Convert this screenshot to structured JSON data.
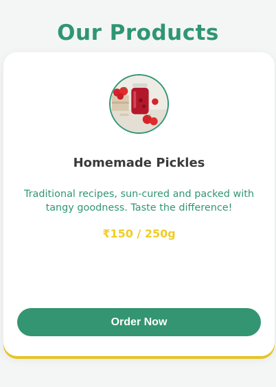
{
  "section": {
    "title": "Our Products"
  },
  "product": {
    "image_icon": "strawberry-jam-jar-image",
    "name": "Homemade Pickles",
    "description": "Traditional recipes, sun-cured and packed with tangy goodness. Taste the difference!",
    "price": "₹150 / 250g",
    "cta_label": "Order Now"
  },
  "colors": {
    "accent_green": "#2f9673",
    "button_green": "#339572",
    "price_yellow": "#f0cc27",
    "text_dark": "#3a3a3a",
    "background": "#f4f6f6"
  }
}
